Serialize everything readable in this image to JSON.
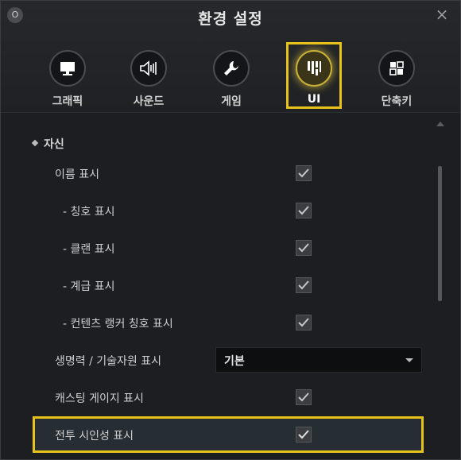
{
  "window": {
    "badge": "O",
    "title": "환경 설정",
    "close": "×"
  },
  "tabs": [
    {
      "label": "그래픽",
      "icon": "monitor-icon"
    },
    {
      "label": "사운드",
      "icon": "speaker-icon"
    },
    {
      "label": "게임",
      "icon": "wrench-icon"
    },
    {
      "label": "UI",
      "icon": "ui-grid-icon",
      "active": true
    },
    {
      "label": "단축키",
      "icon": "shortcut-icon"
    }
  ],
  "section": {
    "label": "자신"
  },
  "rows": [
    {
      "label": "이름 표시",
      "checked": true
    },
    {
      "label": "- 칭호 표시",
      "checked": true
    },
    {
      "label": "- 클랜 표시",
      "checked": true
    },
    {
      "label": "- 계급 표시",
      "checked": true
    },
    {
      "label": "- 컨텐츠 랭커 칭호 표시",
      "checked": true
    },
    {
      "label": "생명력 / 기술자원 표시",
      "select": "기본"
    },
    {
      "label": "캐스팅 게이지 표시",
      "checked": true
    },
    {
      "label": "전투 시인성 표시",
      "checked": true
    }
  ],
  "colors": {
    "accent": "#e7c21a"
  }
}
